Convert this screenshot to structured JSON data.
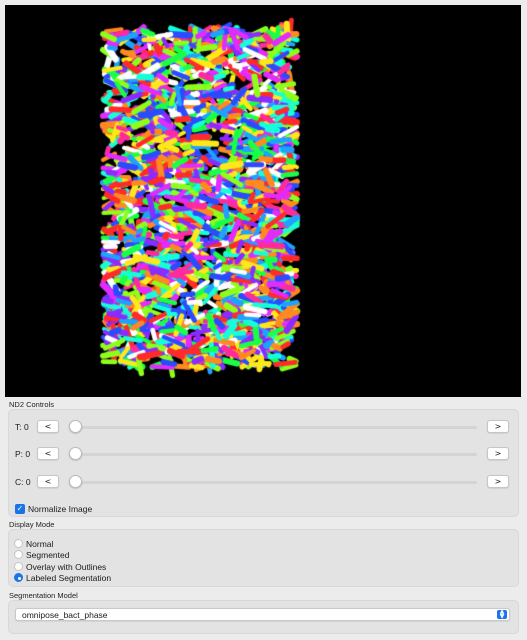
{
  "viewer": {
    "description_colors": [
      "#ff2b2b",
      "#ff8a1f",
      "#ffe81a",
      "#8dff1a",
      "#19ff47",
      "#14ffd9",
      "#1fa2ff",
      "#2b4bff",
      "#8b2bff",
      "#e22bff",
      "#ff2b9d",
      "#ffffff"
    ]
  },
  "nd2_controls": {
    "title": "ND2 Controls",
    "sliders": [
      {
        "label": "T: 0",
        "prev": "<",
        "next": ">",
        "value": 0
      },
      {
        "label": "P: 0",
        "prev": "<",
        "next": ">",
        "value": 0
      },
      {
        "label": "C: 0",
        "prev": "<",
        "next": ">",
        "value": 0
      }
    ],
    "normalize": {
      "label": "Normalize Image",
      "checked": true
    }
  },
  "display_mode": {
    "title": "Display Mode",
    "options": [
      "Normal",
      "Segmented",
      "Overlay with Outlines",
      "Labeled Segmentation"
    ],
    "selected": "Labeled Segmentation"
  },
  "segmentation_model": {
    "title": "Segmentation Model",
    "selected": "omnipose_bact_phase",
    "arrow_up": "▲",
    "arrow_down": "▼"
  },
  "colors": {
    "accent": "#1b73e8",
    "viewer_bg": "#000000"
  }
}
